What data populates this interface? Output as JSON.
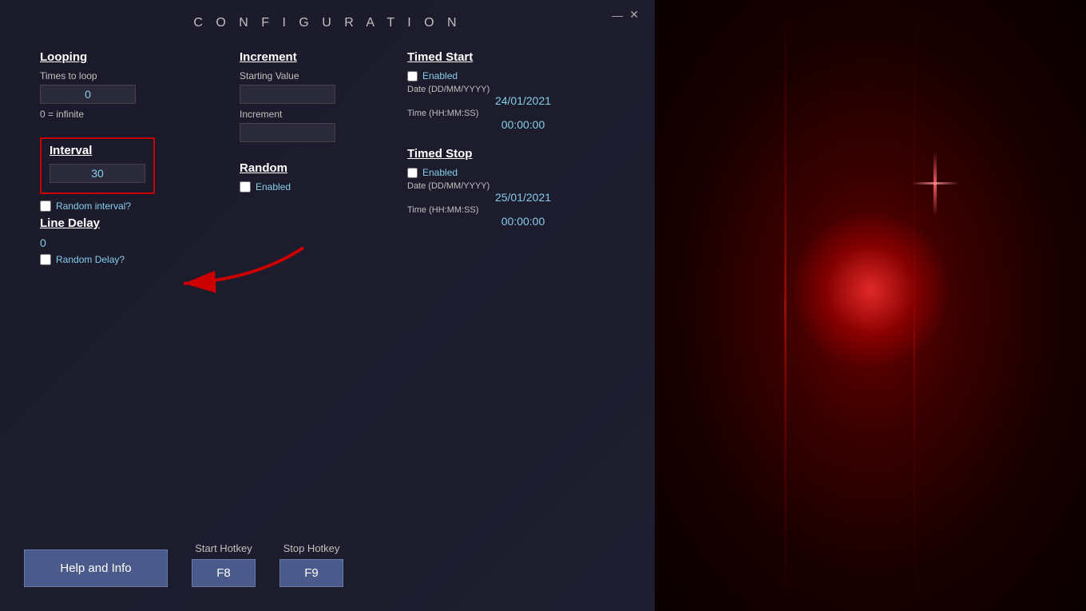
{
  "window": {
    "title": "C O N F I G U R A T I O N",
    "minimize": "—",
    "close": "✕"
  },
  "looping": {
    "title": "Looping",
    "times_label": "Times to loop",
    "value": "0",
    "infinite_label": "0 = infinite"
  },
  "interval": {
    "title": "Interval",
    "value": "30",
    "checkbox_label": "Random interval?"
  },
  "line_delay": {
    "title": "Line Delay",
    "value": "0",
    "checkbox_label": "Random Delay?"
  },
  "increment": {
    "title": "Increment",
    "starting_label": "Starting Value",
    "increment_label": "Increment"
  },
  "random": {
    "title": "Random",
    "checkbox_label": "Enabled"
  },
  "timed_start": {
    "title": "Timed Start",
    "checkbox_label": "Enabled",
    "date_label": "Date (DD/MM/YYYY)",
    "date_value": "24/01/2021",
    "time_label": "Time (HH:MM:SS)",
    "time_value": "00:00:00"
  },
  "timed_stop": {
    "title": "Timed Stop",
    "checkbox_label": "Enabled",
    "date_label": "Date (DD/MM/YYYY)",
    "date_value": "25/01/2021",
    "time_label": "Time (HH:MM:SS)",
    "time_value": "00:00:00"
  },
  "help_button": {
    "label": "Help and Info"
  },
  "hotkeys": {
    "start_label": "Start Hotkey",
    "start_value": "F8",
    "stop_label": "Stop Hotkey",
    "stop_value": "F9"
  }
}
